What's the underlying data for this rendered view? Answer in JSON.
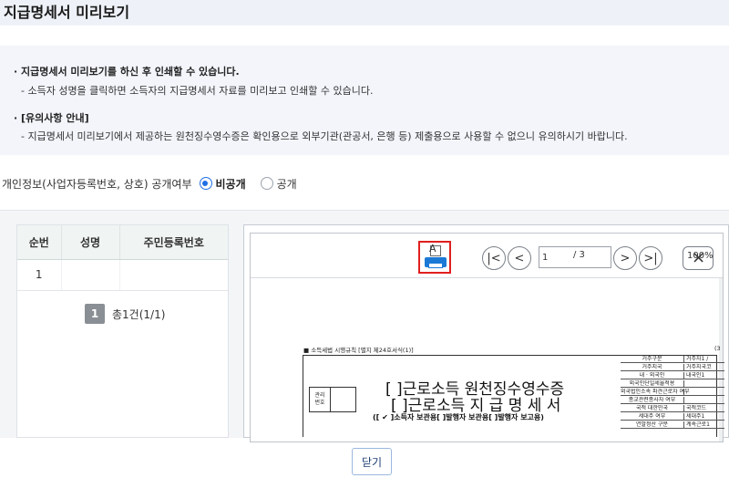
{
  "header": {
    "title": "지급명세서 미리보기"
  },
  "info": {
    "line1": "· 지급명세서 미리보기를 하신 후 인쇄할 수 있습니다.",
    "line2": "- 소득자 성명을 클릭하면 소득자의 지급명세서 자료를 미리보고 인쇄할 수 있습니다.",
    "line3": "· [유의사항 안내]",
    "line4": "- 지급명세서 미리보기에서 제공하는 원천징수영수증은 확인용으로 외부기관(관공서, 은행 등) 제출용으로 사용할 수 없으니 유의하시기 바랍니다."
  },
  "privacy": {
    "label": "개인정보(사업자등록번호, 상호) 공개여부",
    "option_private": "비공개",
    "option_public": "공개",
    "selected": "비공개"
  },
  "list": {
    "headers": [
      "순번",
      "성명",
      "주민등록번호"
    ],
    "rows": [
      {
        "no": "1",
        "name": "",
        "rrn": ""
      }
    ],
    "pager": {
      "page": "1",
      "summary": "총1건(1/1)"
    }
  },
  "viewer": {
    "print_letter": "A",
    "first_symbol": "|<",
    "prev_symbol": "<",
    "page_value": "1",
    "page_total": "/ 3",
    "next_symbol": ">",
    "last_symbol": ">|",
    "zoom": "100%",
    "zoom_close_symbol": "×",
    "doc": {
      "caption": "■ 소득세법 시행규칙 [별지 제24호서식(1)]",
      "caption_right": "(3",
      "mgmt_label": "관리\n번호",
      "title1": "[  ]근로소득 원천징수영수증",
      "title2": "[  ]근로소득 지 급 명 세 서",
      "copy_line": "([ ✔ ]소득자 보관용[     ]발행자 보관용[     ]발행자 보고용)",
      "grid": [
        [
          "거주구분",
          "거주자1 /"
        ],
        [
          "거주지국",
          "거주지국코"
        ],
        [
          "내 · 외국인",
          "내국인1"
        ],
        [
          "외국인단일세율적용",
          ""
        ],
        [
          "외국법인소속 파견근로자 여부",
          ""
        ],
        [
          "종교관련종사자 여부",
          ""
        ],
        [
          "국적   대한민국",
          "국적코드"
        ],
        [
          "세대주 여부",
          "세대주1"
        ],
        [
          "연말정산 구분",
          "계속근로1"
        ]
      ]
    }
  },
  "footer": {
    "close_label": "닫기"
  },
  "colors": {
    "accent": "#1f6fe5",
    "print_highlight": "#e0201f",
    "print_icon": "#1c7ad6"
  }
}
